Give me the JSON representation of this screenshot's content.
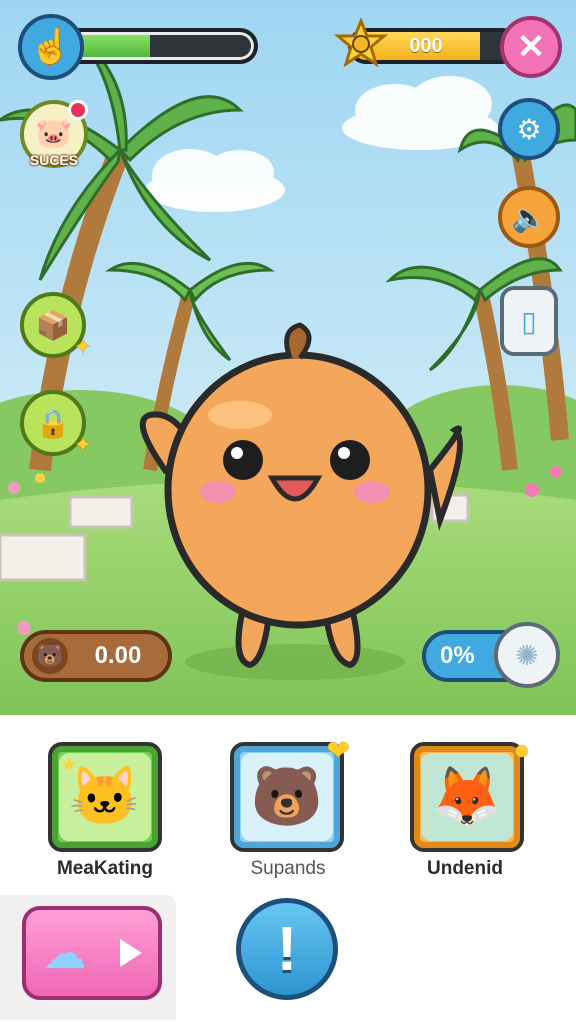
{
  "hud": {
    "energy_level": 0.45,
    "coins": "000",
    "coin_level": 0.78
  },
  "left_menu": {
    "pet_button_label": "SUCES"
  },
  "counters": {
    "food": "0.00",
    "percent": "0%"
  },
  "pets": [
    {
      "name": "MeaKating",
      "icon": "cat-face-icon"
    },
    {
      "name": "Supands",
      "icon": "blue-bear-icon"
    },
    {
      "name": "Undenid",
      "icon": "fox-face-icon"
    }
  ],
  "actions": {
    "info_label": "!"
  },
  "colors": {
    "sky": "#cfeaf7",
    "grass": "#9ad36b",
    "character": "#f4a75a",
    "accent_blue": "#3fa9e0",
    "accent_pink": "#f472b6"
  }
}
